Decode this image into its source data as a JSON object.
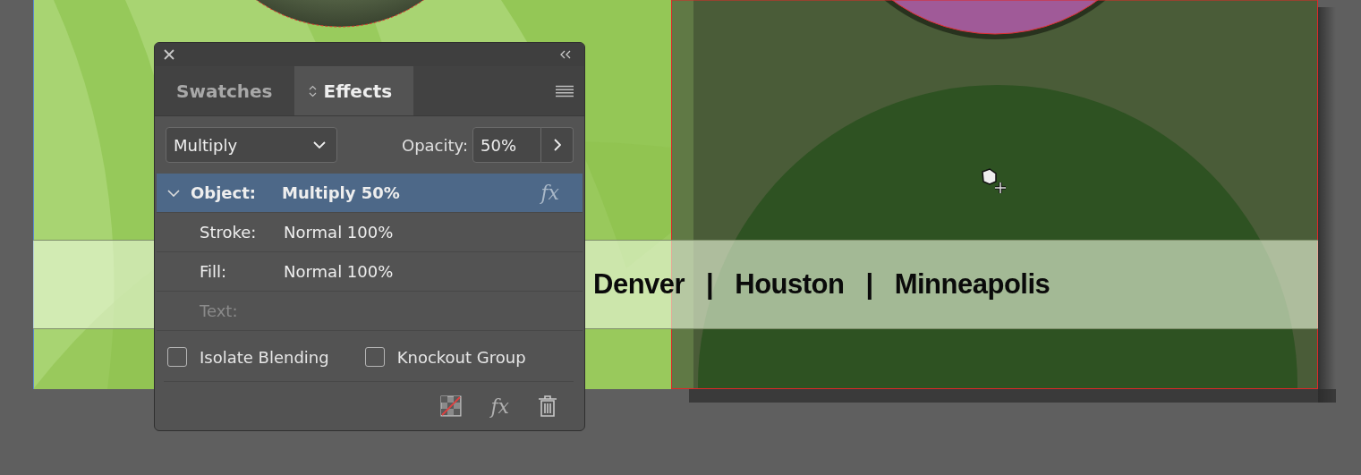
{
  "canvas": {
    "banner_items": [
      {
        "text": "Denver",
        "kind": "city"
      },
      {
        "text": "|",
        "kind": "separator"
      },
      {
        "text": "Houston",
        "kind": "city"
      },
      {
        "text": "|",
        "kind": "separator"
      },
      {
        "text": "Minneapolis",
        "kind": "city"
      }
    ]
  },
  "panel": {
    "tabs": [
      {
        "label": "Swatches",
        "selected": false
      },
      {
        "label": "Effects",
        "selected": true
      }
    ],
    "blend_mode": "Multiply",
    "opacity_label": "Opacity:",
    "opacity_value": "50%",
    "object_row": {
      "label": "Object:",
      "value": "Multiply 50%",
      "selected": true,
      "expanded": true,
      "effects": "fx"
    },
    "attribute_rows": [
      {
        "label": "Stroke:",
        "value": "Normal 100%",
        "disabled": false
      },
      {
        "label": "Fill:",
        "value": "Normal 100%",
        "disabled": false
      },
      {
        "label": "Text:",
        "disabled": true
      }
    ],
    "checkboxes": [
      {
        "label": "Isolate Blending",
        "checked": false
      },
      {
        "label": "Knockout Group",
        "checked": false
      }
    ],
    "footer_fx": "fx"
  }
}
